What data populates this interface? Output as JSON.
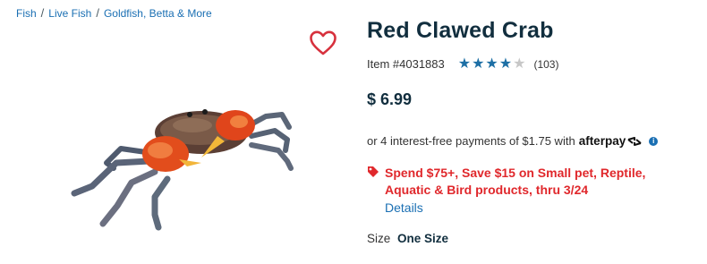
{
  "breadcrumb": {
    "items": [
      "Fish",
      "Live Fish",
      "Goldfish, Betta & More"
    ],
    "separator": "/"
  },
  "product": {
    "title": "Red Clawed Crab",
    "item_label": "Item #4031883",
    "rating": 4,
    "rating_max": 5,
    "review_count": "(103)",
    "price": "$ 6.99",
    "image_icon": "crab-image"
  },
  "payment": {
    "installment_text": "or 4 interest-free payments of $1.75 with",
    "brand": "afterpay",
    "info_icon": "info-icon"
  },
  "promo": {
    "icon": "tag-icon",
    "text": "Spend $75+, Save $15 on Small pet, Reptile, Aquatic & Bird products, thru 3/24",
    "details_link": "Details"
  },
  "size": {
    "label": "Size",
    "value": "One Size"
  },
  "colors": {
    "link": "#1a6fb3",
    "title": "#112e3e",
    "promo": "#e0282c",
    "star": "#1d6fa5",
    "star_empty": "#c7c7c7",
    "heart": "#d7313d"
  }
}
